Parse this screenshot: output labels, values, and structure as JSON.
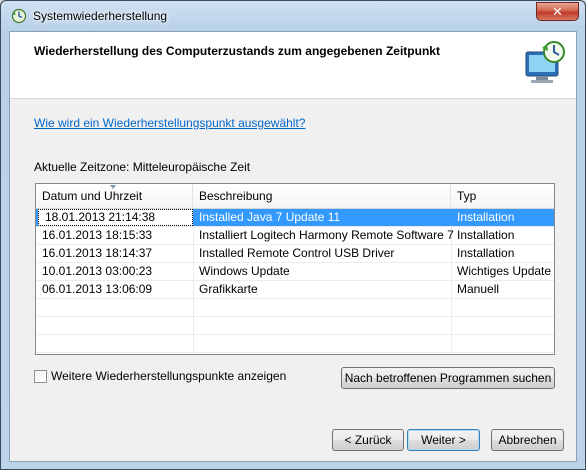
{
  "window": {
    "title": "Systemwiederherstellung",
    "close_glyph": "✕"
  },
  "header": {
    "title": "Wiederherstellung des Computerzustands zum angegebenen Zeitpunkt"
  },
  "help_link": "Wie wird ein Wiederherstellungspunkt ausgewählt?",
  "timezone_label": "Aktuelle Zeitzone: Mitteleuropäische Zeit",
  "table": {
    "columns": [
      "Datum und Uhrzeit",
      "Beschreibung",
      "Typ"
    ],
    "rows": [
      {
        "date": "18.01.2013 21:14:38",
        "desc": "Installed Java 7 Update 11",
        "type": "Installation"
      },
      {
        "date": "16.01.2013 18:15:33",
        "desc": "Installiert Logitech Harmony Remote Software 7",
        "type": "Installation"
      },
      {
        "date": "16.01.2013 18:14:37",
        "desc": "Installed Remote Control USB Driver",
        "type": "Installation"
      },
      {
        "date": "10.01.2013 03:00:23",
        "desc": "Windows Update",
        "type": "Wichtiges Update"
      },
      {
        "date": "06.01.2013 13:06:09",
        "desc": "Grafikkarte",
        "type": "Manuell"
      }
    ],
    "selected_row": 0
  },
  "show_more_checkbox": {
    "label": "Weitere Wiederherstellungspunkte anzeigen",
    "checked": false
  },
  "buttons": {
    "scan": "Nach betroffenen Programmen suchen",
    "back": "< Zurück",
    "next": "Weiter >",
    "cancel": "Abbrechen"
  },
  "colors": {
    "selection": "#3399ff",
    "link": "#0066cc",
    "close_button": "#c0392b"
  }
}
